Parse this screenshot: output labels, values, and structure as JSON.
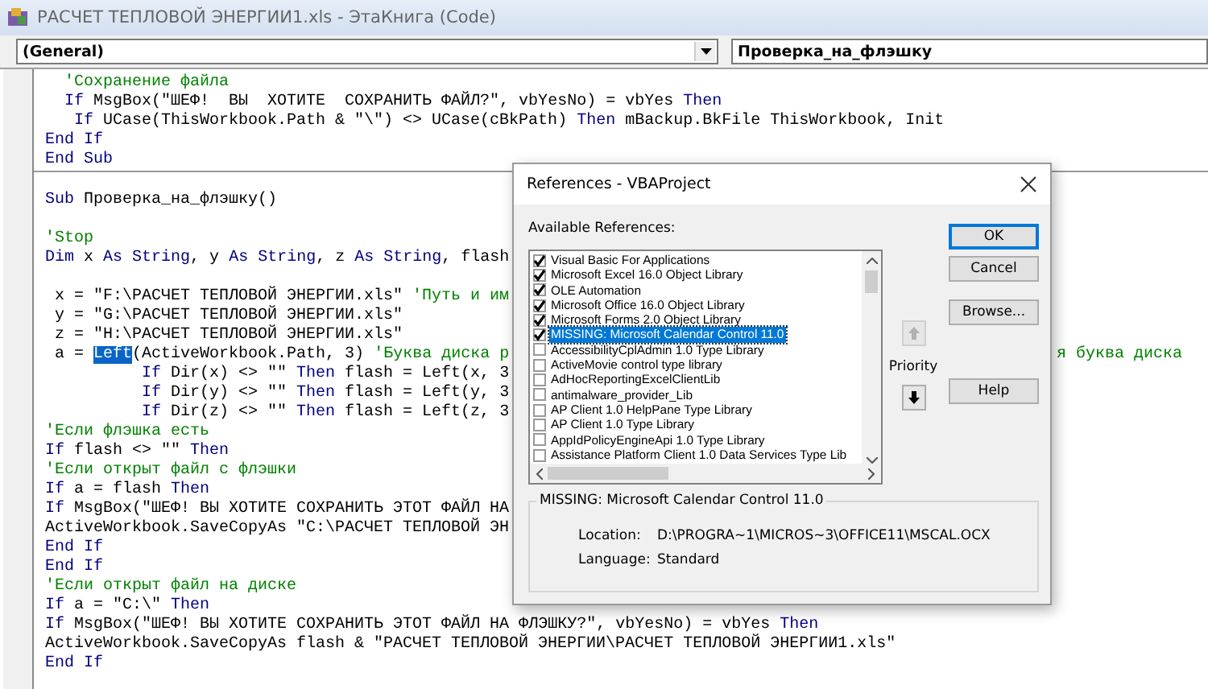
{
  "window": {
    "title": "РАСЧЕТ ТЕПЛОВОЙ ЭНЕРГИИ1.xls - ЭтаКнига (Code)"
  },
  "object_combo": {
    "value": "(General)"
  },
  "procedure_combo": {
    "value": "Проверка_на_флэшку"
  },
  "code_lines": [
    {
      "kind": "code",
      "segments": [
        {
          "kind": "comment",
          "text": "  'Сохранение файла"
        }
      ]
    },
    {
      "kind": "code",
      "segments": [
        {
          "kind": "keyword",
          "text": "  If"
        },
        {
          "kind": "plain",
          "text": " MsgBox(\"ШЕФ!  ВЫ  ХОТИТЕ  СОХРАНИТЬ ФАЙЛ?\", vbYesNo) = vbYes "
        },
        {
          "kind": "keyword",
          "text": "Then"
        }
      ]
    },
    {
      "kind": "code",
      "segments": [
        {
          "kind": "keyword",
          "text": "   If"
        },
        {
          "kind": "plain",
          "text": " UCase(ThisWorkbook.Path & \"\\\") <> UCase(cBkPath) "
        },
        {
          "kind": "keyword",
          "text": "Then"
        },
        {
          "kind": "plain",
          "text": " mBackup.BkFile ThisWorkbook, Init"
        }
      ]
    },
    {
      "kind": "code",
      "segments": [
        {
          "kind": "keyword",
          "text": "End If"
        }
      ]
    },
    {
      "kind": "code",
      "segments": [
        {
          "kind": "keyword",
          "text": "End Sub"
        }
      ]
    },
    {
      "kind": "separator"
    },
    {
      "kind": "blank"
    },
    {
      "kind": "code",
      "segments": [
        {
          "kind": "keyword",
          "text": "Sub"
        },
        {
          "kind": "plain",
          "text": " Проверка_на_флэшку()"
        }
      ]
    },
    {
      "kind": "blank"
    },
    {
      "kind": "code",
      "segments": [
        {
          "kind": "comment",
          "text": "'Stop"
        }
      ]
    },
    {
      "kind": "code",
      "segments": [
        {
          "kind": "keyword",
          "text": "Dim"
        },
        {
          "kind": "plain",
          "text": " x "
        },
        {
          "kind": "keyword",
          "text": "As String"
        },
        {
          "kind": "plain",
          "text": ", y "
        },
        {
          "kind": "keyword",
          "text": "As String"
        },
        {
          "kind": "plain",
          "text": ", z "
        },
        {
          "kind": "keyword",
          "text": "As String"
        },
        {
          "kind": "plain",
          "text": ", flash"
        }
      ]
    },
    {
      "kind": "blank"
    },
    {
      "kind": "code",
      "segments": [
        {
          "kind": "plain",
          "text": " x = \"F:\\РАСЧЕТ ТЕПЛОВОЙ ЭНЕРГИИ.xls\" "
        },
        {
          "kind": "comment",
          "text": "'Путь и им"
        }
      ]
    },
    {
      "kind": "code",
      "segments": [
        {
          "kind": "plain",
          "text": " y = \"G:\\РАСЧЕТ ТЕПЛОВОЙ ЭНЕРГИИ.xls\""
        }
      ]
    },
    {
      "kind": "code",
      "segments": [
        {
          "kind": "plain",
          "text": " z = \"H:\\РАСЧЕТ ТЕПЛОВОЙ ЭНЕРГИИ.xls\""
        }
      ]
    },
    {
      "kind": "code",
      "segments": [
        {
          "kind": "plain",
          "text": " a = "
        },
        {
          "kind": "selection",
          "text": "Left"
        },
        {
          "kind": "plain",
          "text": "(ActiveWorkbook.Path, 3) "
        },
        {
          "kind": "comment",
          "text": "'Буква диска р"
        }
      ],
      "tail": "я буква диска"
    },
    {
      "kind": "code",
      "segments": [
        {
          "kind": "keyword",
          "text": "          If"
        },
        {
          "kind": "plain",
          "text": " Dir(x) <> \"\" "
        },
        {
          "kind": "keyword",
          "text": "Then"
        },
        {
          "kind": "plain",
          "text": " flash = Left(x, 3"
        }
      ]
    },
    {
      "kind": "code",
      "segments": [
        {
          "kind": "keyword",
          "text": "          If"
        },
        {
          "kind": "plain",
          "text": " Dir(y) <> \"\" "
        },
        {
          "kind": "keyword",
          "text": "Then"
        },
        {
          "kind": "plain",
          "text": " flash = Left(y, 3"
        }
      ]
    },
    {
      "kind": "code",
      "segments": [
        {
          "kind": "keyword",
          "text": "          If"
        },
        {
          "kind": "plain",
          "text": " Dir(z) <> \"\" "
        },
        {
          "kind": "keyword",
          "text": "Then"
        },
        {
          "kind": "plain",
          "text": " flash = Left(z, 3"
        }
      ]
    },
    {
      "kind": "code",
      "segments": [
        {
          "kind": "comment",
          "text": "'Если флэшка есть"
        }
      ]
    },
    {
      "kind": "code",
      "segments": [
        {
          "kind": "keyword",
          "text": "If"
        },
        {
          "kind": "plain",
          "text": " flash <> \"\" "
        },
        {
          "kind": "keyword",
          "text": "Then"
        }
      ]
    },
    {
      "kind": "code",
      "segments": [
        {
          "kind": "comment",
          "text": "'Если открыт файл с флэшки"
        }
      ]
    },
    {
      "kind": "code",
      "segments": [
        {
          "kind": "keyword",
          "text": "If"
        },
        {
          "kind": "plain",
          "text": " a = flash "
        },
        {
          "kind": "keyword",
          "text": "Then"
        }
      ]
    },
    {
      "kind": "code",
      "segments": [
        {
          "kind": "keyword",
          "text": "If"
        },
        {
          "kind": "plain",
          "text": " MsgBox(\"ШЕФ! ВЫ ХОТИТЕ СОХРАНИТЬ ЭТОТ ФАЙЛ НА"
        }
      ]
    },
    {
      "kind": "code",
      "segments": [
        {
          "kind": "plain",
          "text": "ActiveWorkbook.SaveCopyAs \"C:\\РАСЧЕТ ТЕПЛОВОЙ ЭН"
        }
      ]
    },
    {
      "kind": "code",
      "segments": [
        {
          "kind": "keyword",
          "text": "End If"
        }
      ]
    },
    {
      "kind": "code",
      "segments": [
        {
          "kind": "keyword",
          "text": "End If"
        }
      ]
    },
    {
      "kind": "code",
      "segments": [
        {
          "kind": "comment",
          "text": "'Если открыт файл на диске"
        }
      ]
    },
    {
      "kind": "code",
      "segments": [
        {
          "kind": "keyword",
          "text": "If"
        },
        {
          "kind": "plain",
          "text": " a = \"C:\\\" "
        },
        {
          "kind": "keyword",
          "text": "Then"
        }
      ]
    },
    {
      "kind": "code",
      "segments": [
        {
          "kind": "keyword",
          "text": "If"
        },
        {
          "kind": "plain",
          "text": " MsgBox(\"ШЕФ! ВЫ ХОТИТЕ СОХРАНИТЬ ЭТОТ ФАЙЛ НА ФЛЭШКУ?\", vbYesNo) = vbYes "
        },
        {
          "kind": "keyword",
          "text": "Then"
        }
      ]
    },
    {
      "kind": "code",
      "segments": [
        {
          "kind": "plain",
          "text": "ActiveWorkbook.SaveCopyAs flash & \"РАСЧЕТ ТЕПЛОВОЙ ЭНЕРГИИ\\РАСЧЕТ ТЕПЛОВОЙ ЭНЕРГИИ1.xls\""
        }
      ]
    },
    {
      "kind": "code",
      "segments": [
        {
          "kind": "keyword",
          "text": "End If"
        }
      ]
    }
  ],
  "dialog": {
    "title": "References - VBAProject",
    "available_label": "Available References:",
    "references": [
      {
        "label": "Visual Basic For Applications",
        "checked": true,
        "selected": false
      },
      {
        "label": "Microsoft Excel 16.0 Object Library",
        "checked": true,
        "selected": false
      },
      {
        "label": "OLE Automation",
        "checked": true,
        "selected": false
      },
      {
        "label": "Microsoft Office 16.0 Object Library",
        "checked": true,
        "selected": false
      },
      {
        "label": "Microsoft Forms 2.0 Object Library",
        "checked": true,
        "selected": false
      },
      {
        "label": "MISSING: Microsoft Calendar Control 11.0",
        "checked": true,
        "selected": true
      },
      {
        "label": "AccessibilityCplAdmin 1.0 Type Library",
        "checked": false,
        "selected": false
      },
      {
        "label": "ActiveMovie control type library",
        "checked": false,
        "selected": false
      },
      {
        "label": "AdHocReportingExcelClientLib",
        "checked": false,
        "selected": false
      },
      {
        "label": "antimalware_provider_Lib",
        "checked": false,
        "selected": false
      },
      {
        "label": "AP Client 1.0 HelpPane Type Library",
        "checked": false,
        "selected": false
      },
      {
        "label": "AP Client 1.0 Type Library",
        "checked": false,
        "selected": false
      },
      {
        "label": "AppIdPolicyEngineApi 1.0 Type Library",
        "checked": false,
        "selected": false
      },
      {
        "label": "Assistance Platform Client 1.0 Data Services Type Lib",
        "checked": false,
        "selected": false
      }
    ],
    "priority_label": "Priority",
    "priority_buttons": [
      {
        "kind": "up",
        "disabled": true
      },
      {
        "kind": "down",
        "disabled": false
      }
    ],
    "buttons": [
      {
        "label": "OK",
        "default": true
      },
      {
        "label": "Cancel",
        "default": false
      },
      {
        "label": "Browse...",
        "default": false
      },
      {
        "label": "Help",
        "default": false
      }
    ],
    "details": {
      "legend": "MISSING: Microsoft Calendar Control 11.0",
      "fields": [
        {
          "label": "Location:",
          "value": "D:\\PROGRA~1\\MICROS~3\\OFFICE11\\MSCAL.OCX"
        },
        {
          "label": "Language:",
          "value": "Standard"
        }
      ]
    }
  }
}
